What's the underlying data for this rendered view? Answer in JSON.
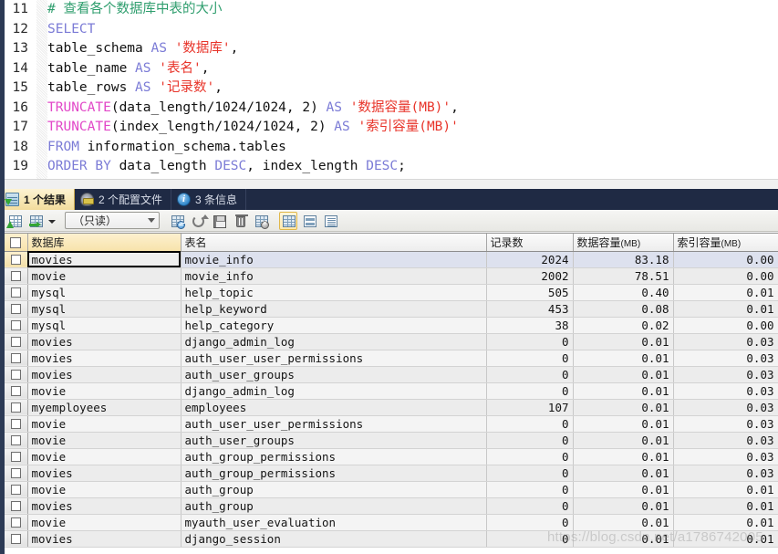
{
  "editor": {
    "lines": [
      {
        "num": "11",
        "tokens": [
          {
            "t": "comment",
            "v": "# 查看各个数据库中表的大小"
          }
        ]
      },
      {
        "num": "12",
        "tokens": [
          {
            "t": "kw",
            "v": "SELECT"
          }
        ]
      },
      {
        "num": "13",
        "tokens": [
          {
            "t": "plain",
            "v": "table_schema "
          },
          {
            "t": "kw",
            "v": "AS"
          },
          {
            "t": "plain",
            "v": " "
          },
          {
            "t": "str",
            "v": "'数据库'"
          },
          {
            "t": "punct",
            "v": ","
          }
        ]
      },
      {
        "num": "14",
        "tokens": [
          {
            "t": "plain",
            "v": "table_name "
          },
          {
            "t": "kw",
            "v": "AS"
          },
          {
            "t": "plain",
            "v": " "
          },
          {
            "t": "str",
            "v": "'表名'"
          },
          {
            "t": "punct",
            "v": ","
          }
        ]
      },
      {
        "num": "15",
        "tokens": [
          {
            "t": "plain",
            "v": "table_rows "
          },
          {
            "t": "kw",
            "v": "AS"
          },
          {
            "t": "plain",
            "v": " "
          },
          {
            "t": "str",
            "v": "'记录数'"
          },
          {
            "t": "punct",
            "v": ","
          }
        ]
      },
      {
        "num": "16",
        "tokens": [
          {
            "t": "fn",
            "v": "TRUNCATE"
          },
          {
            "t": "plain",
            "v": "(data_length/1024/1024, 2) "
          },
          {
            "t": "kw",
            "v": "AS"
          },
          {
            "t": "plain",
            "v": " "
          },
          {
            "t": "str",
            "v": "'数据容量(MB)'"
          },
          {
            "t": "punct",
            "v": ","
          }
        ]
      },
      {
        "num": "17",
        "tokens": [
          {
            "t": "fn",
            "v": "TRUNCATE"
          },
          {
            "t": "plain",
            "v": "(index_length/1024/1024, 2) "
          },
          {
            "t": "kw",
            "v": "AS"
          },
          {
            "t": "plain",
            "v": " "
          },
          {
            "t": "str",
            "v": "'索引容量(MB)'"
          }
        ]
      },
      {
        "num": "18",
        "tokens": [
          {
            "t": "kw",
            "v": "FROM"
          },
          {
            "t": "plain",
            "v": " information_schema.tables"
          }
        ]
      },
      {
        "num": "19",
        "tokens": [
          {
            "t": "kw",
            "v": "ORDER BY"
          },
          {
            "t": "plain",
            "v": " data_length "
          },
          {
            "t": "kw",
            "v": "DESC"
          },
          {
            "t": "punct",
            "v": ","
          },
          {
            "t": "plain",
            "v": " index_length "
          },
          {
            "t": "kw",
            "v": "DESC"
          },
          {
            "t": "punct",
            "v": ";"
          }
        ]
      }
    ]
  },
  "tabs": [
    {
      "label": "1 个结果",
      "icon": "result-grid-icon",
      "active": true
    },
    {
      "label": "2 个配置文件",
      "icon": "profile-icon",
      "active": false
    },
    {
      "label": "3 条信息",
      "icon": "info-icon",
      "active": false
    }
  ],
  "toolbar": {
    "buttons": [
      {
        "name": "new-record-button",
        "icon": "grid-plus-icon"
      },
      {
        "name": "apply-record-button",
        "icon": "grid-arrow-icon"
      },
      {
        "name": "add-row-button",
        "icon": "grid-add-icon"
      },
      {
        "name": "refresh-button",
        "icon": "refresh-icon"
      },
      {
        "name": "save-button",
        "icon": "floppy-disk-icon"
      },
      {
        "name": "delete-button",
        "icon": "trash-icon"
      },
      {
        "name": "remove-row-button",
        "icon": "grid-remove-icon"
      },
      {
        "name": "grid-view-button",
        "icon": "grid-view-icon"
      },
      {
        "name": "form-view-button",
        "icon": "form-view-icon"
      },
      {
        "name": "text-view-button",
        "icon": "text-view-icon"
      }
    ],
    "mode_select": {
      "value": "（只读）"
    }
  },
  "grid": {
    "columns": [
      {
        "key": "chk",
        "label": "",
        "align": "center",
        "sorted": true
      },
      {
        "key": "db",
        "label": "数据库",
        "align": "left",
        "sorted": true
      },
      {
        "key": "tbl",
        "label": "表名",
        "align": "left",
        "sorted": false
      },
      {
        "key": "rows",
        "label": "记录数",
        "align": "left",
        "sorted": false
      },
      {
        "key": "data",
        "label": "数据容量",
        "unit": "(MB)",
        "align": "left",
        "sorted": false
      },
      {
        "key": "idx",
        "label": "索引容量",
        "unit": "(MB)",
        "align": "left",
        "sorted": false
      }
    ],
    "rows": [
      {
        "db": "movies",
        "tbl": "movie_info",
        "rows": "2024",
        "data": "83.18",
        "idx": "0.00",
        "selected": true
      },
      {
        "db": "movie",
        "tbl": "movie_info",
        "rows": "2002",
        "data": "78.51",
        "idx": "0.00"
      },
      {
        "db": "mysql",
        "tbl": "help_topic",
        "rows": "505",
        "data": "0.40",
        "idx": "0.01"
      },
      {
        "db": "mysql",
        "tbl": "help_keyword",
        "rows": "453",
        "data": "0.08",
        "idx": "0.01"
      },
      {
        "db": "mysql",
        "tbl": "help_category",
        "rows": "38",
        "data": "0.02",
        "idx": "0.00"
      },
      {
        "db": "movies",
        "tbl": "django_admin_log",
        "rows": "0",
        "data": "0.01",
        "idx": "0.03"
      },
      {
        "db": "movies",
        "tbl": "auth_user_user_permissions",
        "rows": "0",
        "data": "0.01",
        "idx": "0.03"
      },
      {
        "db": "movies",
        "tbl": "auth_user_groups",
        "rows": "0",
        "data": "0.01",
        "idx": "0.03"
      },
      {
        "db": "movie",
        "tbl": "django_admin_log",
        "rows": "0",
        "data": "0.01",
        "idx": "0.03"
      },
      {
        "db": "myemployees",
        "tbl": "employees",
        "rows": "107",
        "data": "0.01",
        "idx": "0.03"
      },
      {
        "db": "movie",
        "tbl": "auth_user_user_permissions",
        "rows": "0",
        "data": "0.01",
        "idx": "0.03"
      },
      {
        "db": "movie",
        "tbl": "auth_user_groups",
        "rows": "0",
        "data": "0.01",
        "idx": "0.03"
      },
      {
        "db": "movie",
        "tbl": "auth_group_permissions",
        "rows": "0",
        "data": "0.01",
        "idx": "0.03"
      },
      {
        "db": "movies",
        "tbl": "auth_group_permissions",
        "rows": "0",
        "data": "0.01",
        "idx": "0.03"
      },
      {
        "db": "movie",
        "tbl": "auth_group",
        "rows": "0",
        "data": "0.01",
        "idx": "0.01"
      },
      {
        "db": "movies",
        "tbl": "auth_group",
        "rows": "0",
        "data": "0.01",
        "idx": "0.01"
      },
      {
        "db": "movie",
        "tbl": "myauth_user_evaluation",
        "rows": "0",
        "data": "0.01",
        "idx": "0.01"
      },
      {
        "db": "movies",
        "tbl": "django_session",
        "rows": "0",
        "data": "0.01",
        "idx": "0.01"
      }
    ]
  },
  "watermark": {
    "text": "https://blog.csdn.net/a1786742005"
  }
}
